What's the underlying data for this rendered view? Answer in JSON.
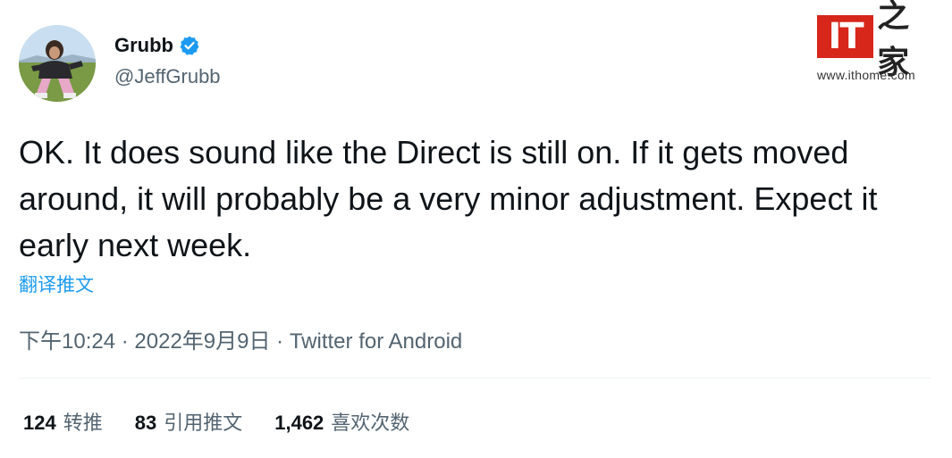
{
  "author": {
    "display_name": "Grubb",
    "handle": "@JeffGrubb",
    "verified": true
  },
  "watermark": {
    "logo_text": "IT",
    "logo_cn": "之家",
    "url": "www.ithome.com"
  },
  "tweet": {
    "text": "OK. It does sound like the Direct is still on. If it gets moved around, it will probably be a very minor adjustment. Expect it early next week.",
    "translate_label": "翻译推文"
  },
  "meta": {
    "time": "下午10:24",
    "separator": "·",
    "date": "2022年9月9日",
    "source": "Twitter for Android"
  },
  "stats": [
    {
      "count": "124",
      "label": "转推"
    },
    {
      "count": "83",
      "label": "引用推文"
    },
    {
      "count": "1,462",
      "label": "喜欢次数"
    }
  ],
  "colors": {
    "link": "#1d9bf0",
    "secondary_text": "#536471",
    "verified_badge": "#1d9bf0",
    "watermark_red": "#d7261a"
  }
}
